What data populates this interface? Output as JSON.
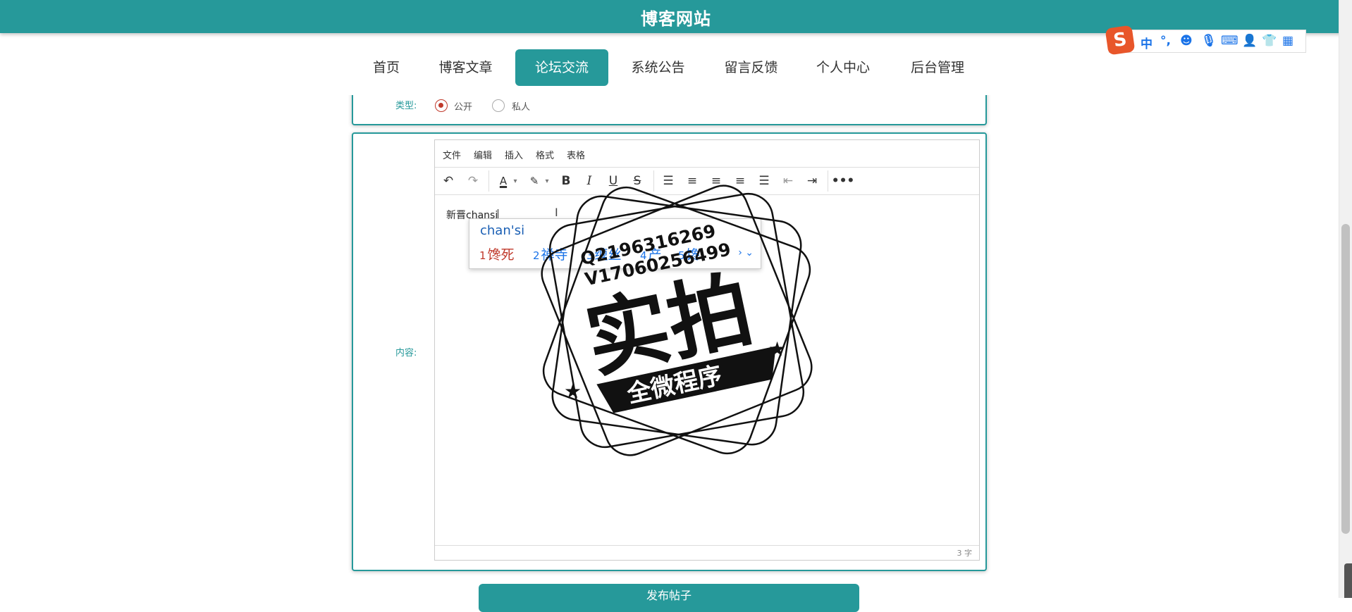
{
  "header": {
    "title": "博客网站"
  },
  "nav": {
    "items": [
      {
        "label": "首页"
      },
      {
        "label": "博客文章"
      },
      {
        "label": "论坛交流",
        "active": true
      },
      {
        "label": "系统公告"
      },
      {
        "label": "留言反馈"
      },
      {
        "label": "个人中心"
      },
      {
        "label": "后台管理"
      }
    ]
  },
  "form": {
    "type_label": "类型:",
    "type_options": [
      {
        "label": "公开",
        "checked": true
      },
      {
        "label": "私人",
        "checked": false
      }
    ],
    "content_label": "内容:",
    "submit_label": "发布帖子"
  },
  "editor": {
    "menus": [
      "文件",
      "编辑",
      "插入",
      "格式",
      "表格"
    ],
    "toolbar_icons": [
      "undo-icon",
      "redo-icon",
      "font-color-icon",
      "highlight-icon",
      "bold-icon",
      "italic-icon",
      "underline-icon",
      "strikethrough-icon",
      "line-height-icon",
      "align-left-icon",
      "align-center-icon",
      "align-right-icon",
      "justify-icon",
      "outdent-icon",
      "indent-icon",
      "more-icon"
    ],
    "content": "新晋chansi",
    "word_count": "3 字"
  },
  "ime": {
    "input": "chan'si",
    "candidates": [
      {
        "num": "1",
        "text": "馋死"
      },
      {
        "num": "2",
        "text": "禅寺"
      },
      {
        "num": "3",
        "text": "缠丝"
      },
      {
        "num": "4",
        "text": "产"
      },
      {
        "num": "5",
        "text": "馋"
      }
    ],
    "toolbar_mode": "中",
    "toolbar_punct": "°,",
    "toolbar_icons": [
      "emoji-icon",
      "mic-icon",
      "keyboard-icon",
      "user-icon",
      "skin-icon",
      "apps-icon"
    ]
  },
  "watermark": {
    "contact1": "Q2196316269",
    "contact2": "V17060256499",
    "main_text": "实拍",
    "banner_text": "全微程序"
  },
  "colors": {
    "primary": "#26999a",
    "ime_blue": "#1a73e8",
    "ime_red": "#c0392b"
  }
}
